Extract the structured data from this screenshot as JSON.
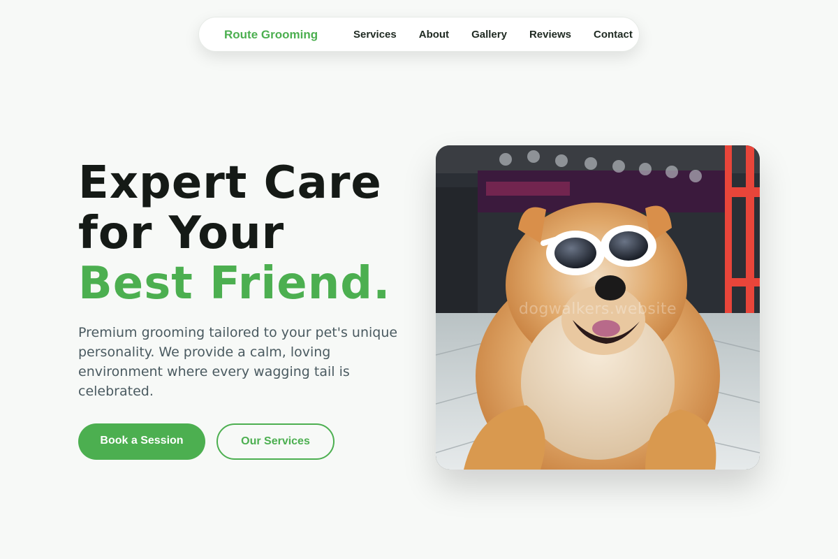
{
  "nav": {
    "brand": "Route Grooming",
    "links": [
      {
        "label": "Services"
      },
      {
        "label": "About"
      },
      {
        "label": "Gallery"
      },
      {
        "label": "Reviews"
      },
      {
        "label": "Contact"
      }
    ]
  },
  "hero": {
    "headline_line1": "Expert Care",
    "headline_line2": "for Your",
    "headline_accent": "Best Friend.",
    "description": "Premium grooming tailored to your pet's unique personality. We provide a calm, loving environment where every wagging tail is celebrated.",
    "primary_cta": "Book a Session",
    "secondary_cta": "Our Services",
    "image_watermark": "dogwalkers.website"
  },
  "colors": {
    "accent": "#4caf50",
    "text_dark": "#151a16",
    "text_muted": "#4a5a60",
    "background": "#f7f9f7"
  }
}
